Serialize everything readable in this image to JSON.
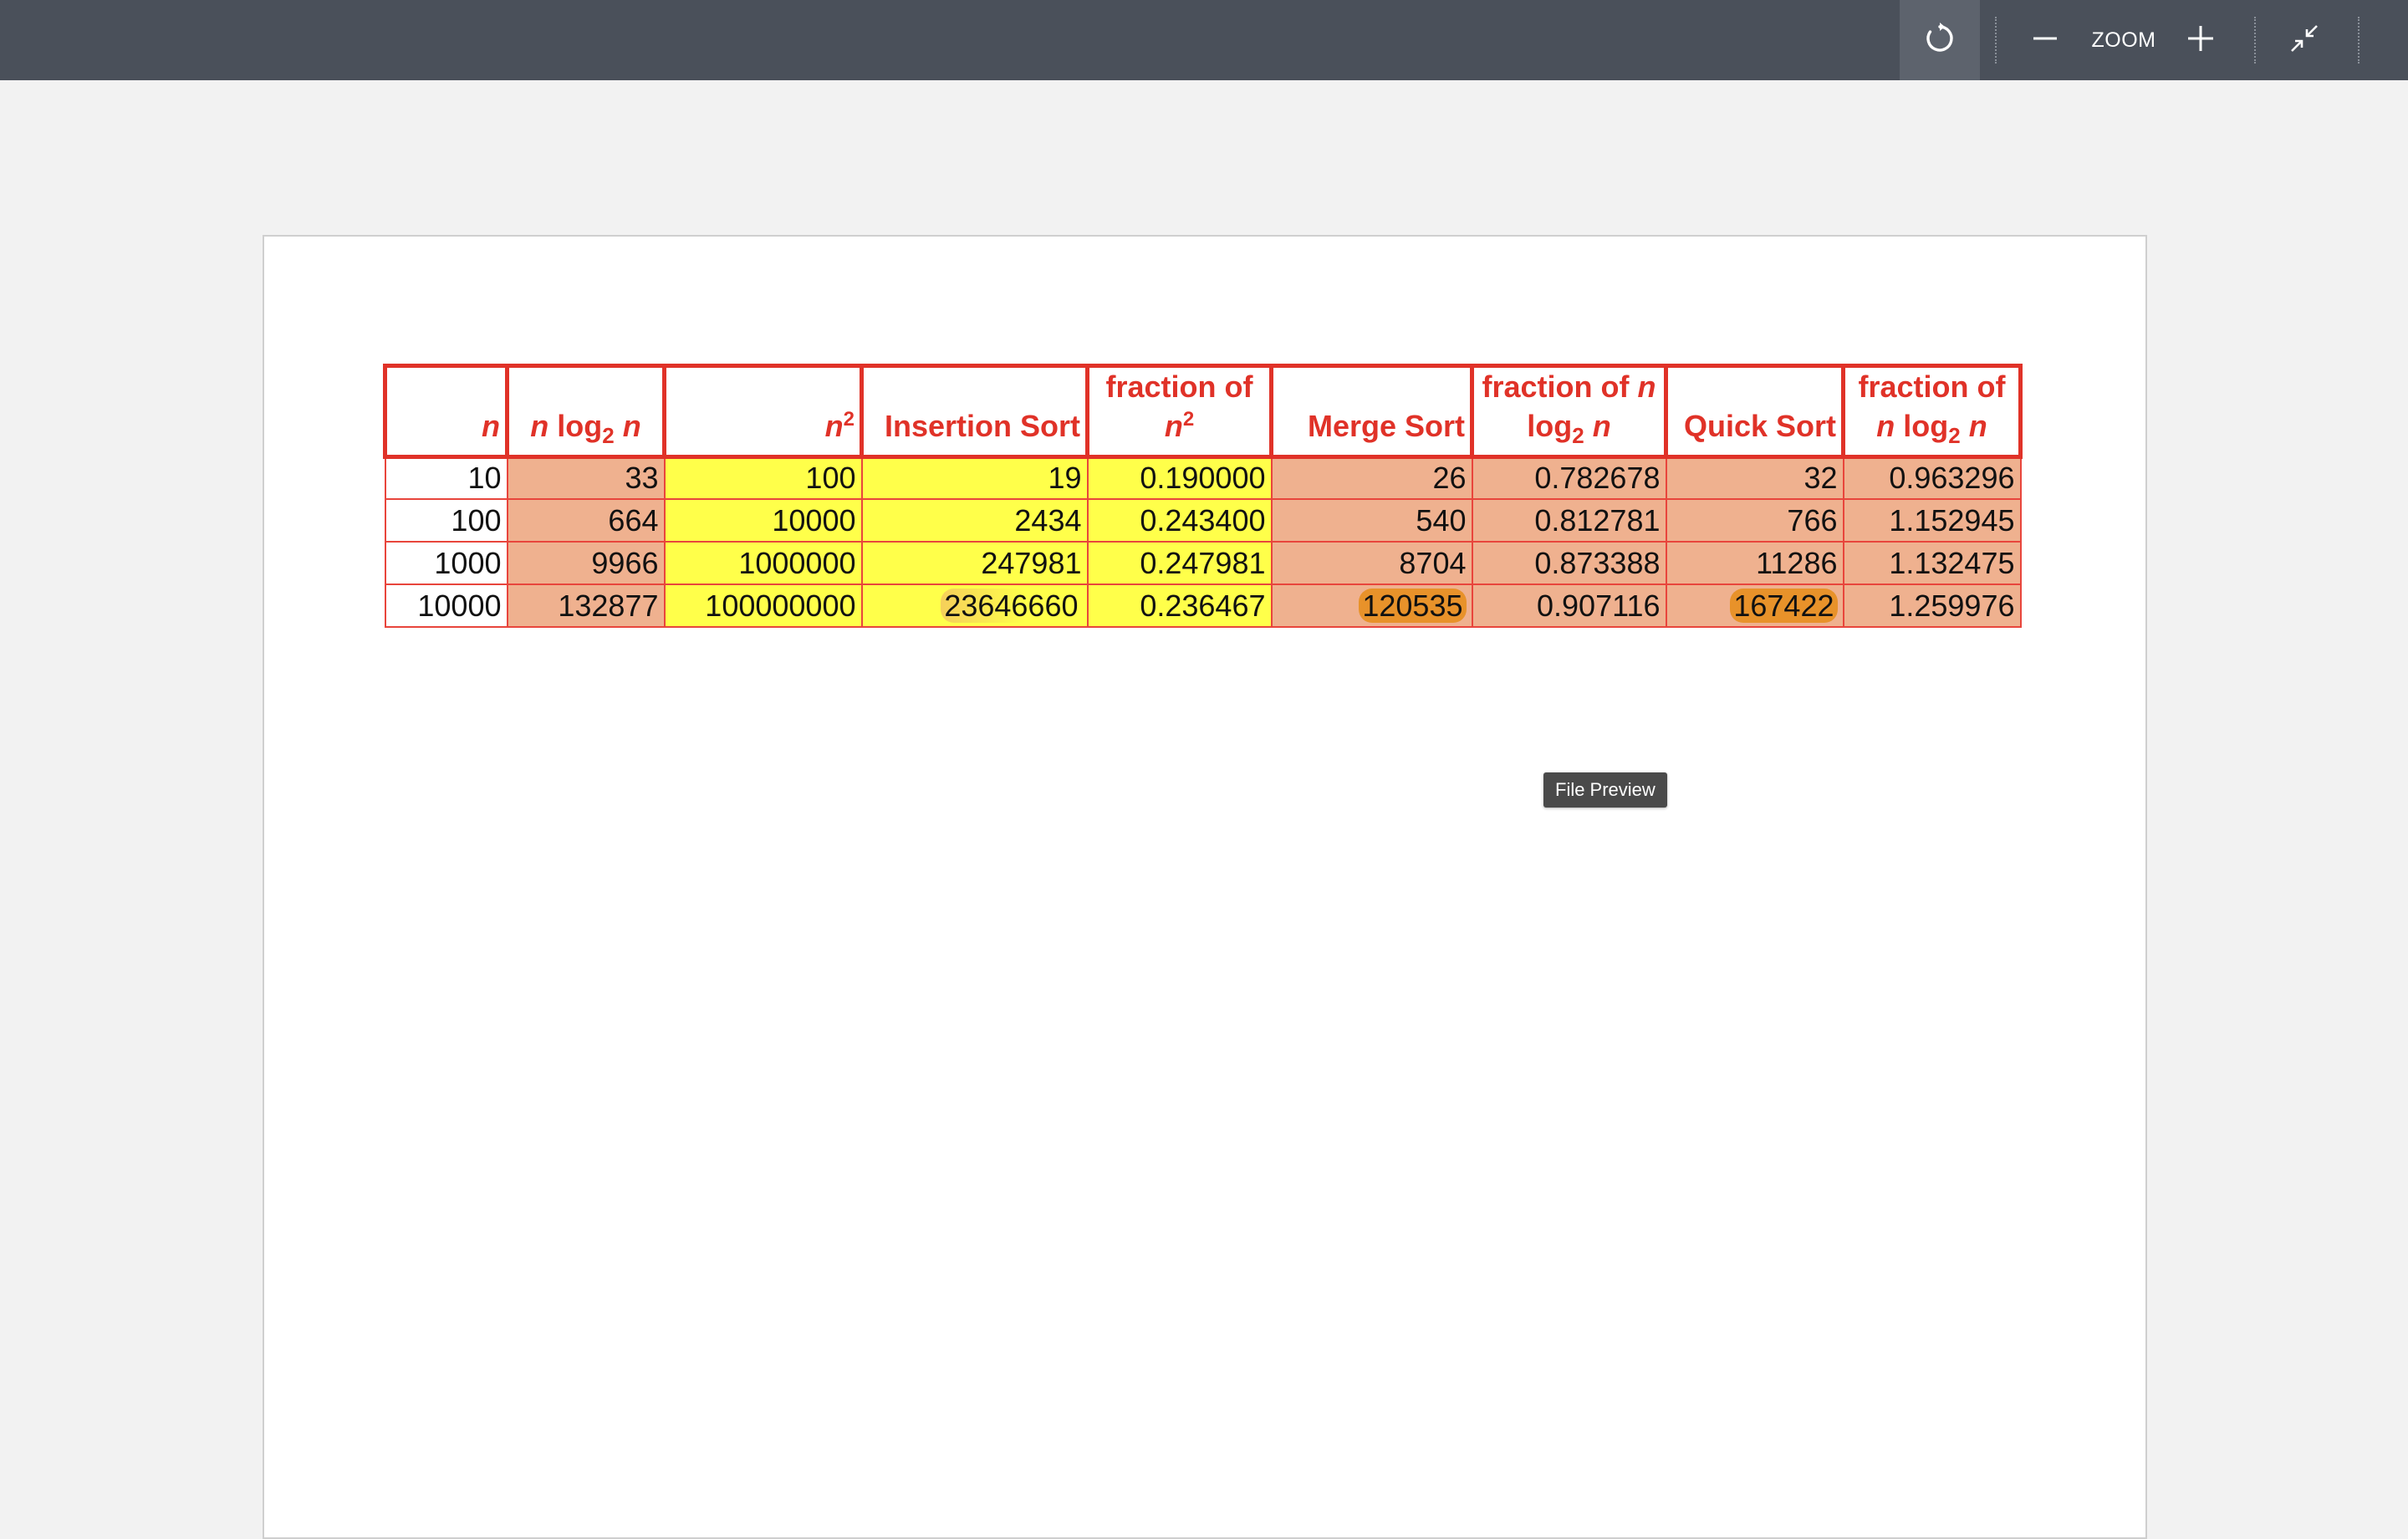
{
  "toolbar": {
    "zoom_label": "ZOOM",
    "refresh_icon": "refresh-icon",
    "zoom_out_icon": "minus-icon",
    "zoom_in_icon": "plus-icon",
    "collapse_icon": "collapse-arrows-icon"
  },
  "table": {
    "headers": {
      "n": "n",
      "nlog_pre": "n",
      "nlog_log": "log",
      "nlog_sub": "2",
      "nlog_post": "n",
      "n2_base": "n",
      "n2_sup": "2",
      "insertion": "Insertion Sort",
      "frac_n2_line1": "fraction of",
      "frac_n2_base": "n",
      "frac_n2_sup": "2",
      "merge": "Merge Sort",
      "frac_merge_line1": "fraction of",
      "frac_merge_line1_var": "n",
      "frac_merge_log": "log",
      "frac_merge_sub": "2",
      "frac_merge_post": "n",
      "quick": "Quick Sort",
      "frac_quick_line1": "fraction of",
      "frac_quick_pre": "n",
      "frac_quick_log": "log",
      "frac_quick_sub": "2",
      "frac_quick_post": "n"
    },
    "rows": [
      {
        "n": "10",
        "nlogn": "33",
        "n2": "100",
        "insertion": "19",
        "frac_n2": "0.190000",
        "merge": "26",
        "frac_merge": "0.782678",
        "quick": "32",
        "frac_quick": "0.963296"
      },
      {
        "n": "100",
        "nlogn": "664",
        "n2": "10000",
        "insertion": "2434",
        "frac_n2": "0.243400",
        "merge": "540",
        "frac_merge": "0.812781",
        "quick": "766",
        "frac_quick": "1.152945"
      },
      {
        "n": "1000",
        "nlogn": "9966",
        "n2": "1000000",
        "insertion": "247981",
        "frac_n2": "0.247981",
        "merge": "8704",
        "frac_merge": "0.873388",
        "quick": "11286",
        "frac_quick": "1.132475"
      },
      {
        "n": "10000",
        "nlogn": "132877",
        "n2": "100000000",
        "insertion": "23646660",
        "frac_n2": "0.236467",
        "merge": "120535",
        "frac_merge": "0.907116",
        "quick": "167422",
        "frac_quick": "1.259976"
      }
    ]
  },
  "tooltip": {
    "text": "File Preview"
  }
}
